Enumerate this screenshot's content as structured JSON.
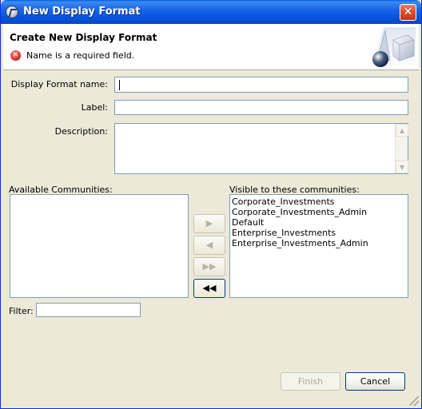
{
  "window": {
    "title": "New Display Format",
    "close_glyph": "✕"
  },
  "banner": {
    "heading": "Create New Display Format",
    "error_message": "Name is a required field."
  },
  "form": {
    "name_label": "Display Format name:",
    "name_value": "",
    "label_label": "Label:",
    "label_value": "",
    "description_label": "Description:",
    "description_value": ""
  },
  "communities": {
    "available_label": "Available Communities:",
    "available_items": [],
    "visible_label": "Visible to these communities:",
    "visible_items": [
      "Corporate_Investments",
      "Corporate_Investments_Admin",
      "Default",
      "Enterprise_Investments",
      "Enterprise_Investments_Admin"
    ],
    "buttons": {
      "add": "▶",
      "remove": "◀",
      "add_all": "▶▶",
      "remove_all": "◀◀"
    },
    "filter_label": "Filter:",
    "filter_value": ""
  },
  "footer": {
    "finish_label": "Finish",
    "cancel_label": "Cancel"
  },
  "icons": {
    "scroll_up": "▲",
    "scroll_down": "▼",
    "error": "✕"
  }
}
